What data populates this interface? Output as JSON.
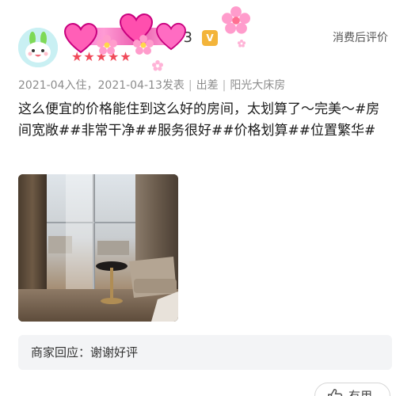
{
  "user": {
    "name_suffix": "93",
    "level_badge": "V",
    "stars": "★★★★★",
    "avatar_icon": "bunny-avatar-icon"
  },
  "header": {
    "review_after_stay_label": "消费后评价"
  },
  "meta": {
    "checkin": "2021-04入住",
    "posted": "2021-04-13发表",
    "trip_type": "出差",
    "room_type": "阳光大床房"
  },
  "review": {
    "text": "这么便宜的价格能住到这么好的房间，太划算了～完美～#房间宽敞##非常干净##服务很好##价格划算##位置繁华#"
  },
  "photo": {
    "icon": "room-photo"
  },
  "merchant_reply": {
    "text": "商家回应：谢谢好评"
  },
  "actions": {
    "useful_label": "有用",
    "useful_icon": "thumbs-up-icon"
  },
  "colors": {
    "meta_gray": "#8c8c8c",
    "star_red": "#f04a5a",
    "badge_gold": "#f3b43a",
    "reply_bg": "#f3f4f6",
    "sticker_pink": "#ff5fb7"
  }
}
